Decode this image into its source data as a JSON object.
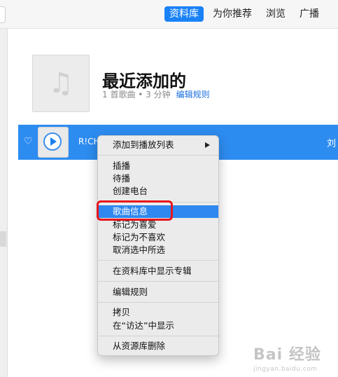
{
  "nav": {
    "tabs": [
      {
        "label": "资料库",
        "active": true
      },
      {
        "label": "为你推荐",
        "active": false
      },
      {
        "label": "浏览",
        "active": false
      },
      {
        "label": "广播",
        "active": false
      }
    ]
  },
  "playlist": {
    "title": "最近添加的",
    "meta": "1 首歌曲 • 3 分钟",
    "edit_rules": "编辑规则"
  },
  "song": {
    "title": "R!CH",
    "artist": "刘"
  },
  "context_menu": {
    "items": [
      {
        "label": "添加到播放列表",
        "submenu": true
      },
      {
        "label": "插播"
      },
      {
        "label": "待播"
      },
      {
        "label": "创建电台"
      },
      {
        "label": "歌曲信息",
        "highlighted": true
      },
      {
        "label": "标记为喜爱"
      },
      {
        "label": "标记为不喜欢"
      },
      {
        "label": "取消选中所选"
      },
      {
        "label": "在资料库中显示专辑"
      },
      {
        "label": "编辑规则"
      },
      {
        "label": "拷贝"
      },
      {
        "label": "在“访达”中显示"
      },
      {
        "label": "从资源库删除"
      }
    ]
  },
  "watermark": {
    "logo": "Bai 经验",
    "url": "jingyan.baidu.com"
  },
  "colors": {
    "accent": "#1a82f7",
    "selection_row": "#2d8cf0",
    "menu_highlight": "#2f88ef",
    "annotation_box": "#e8161c"
  },
  "icons": {
    "artwork": "music-note-icon",
    "heart": "heart-icon",
    "play": "play-icon",
    "submenu": "chevron-right-icon"
  }
}
